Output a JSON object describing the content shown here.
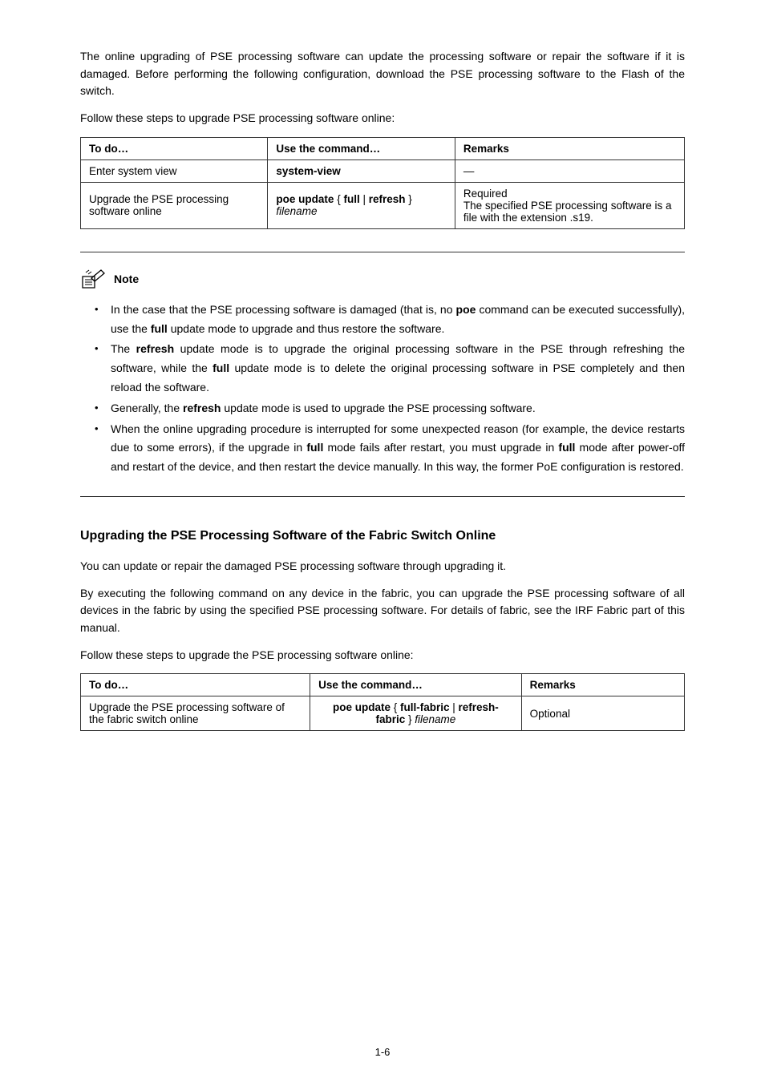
{
  "intro": {
    "p1": "The online upgrading of PSE processing software can update the processing software or repair the software if it is damaged. Before performing the following configuration, download the PSE processing software to the Flash of the switch.",
    "p2": "Follow these steps to upgrade PSE processing software online:"
  },
  "table1": {
    "headers": {
      "c1": "To do…",
      "c2": "Use the command…",
      "c3": "Remarks"
    },
    "rows": [
      {
        "c1": "Enter system view",
        "c2": "system-view",
        "c3": "—"
      },
      {
        "c1": "Upgrade the PSE processing software online",
        "c2": "poe update { full | refresh } filename",
        "c3": "Required\nThe specified PSE processing software is a file with the extension .s19."
      }
    ]
  },
  "note": {
    "label": "Note",
    "bullets": [
      {
        "parts": [
          "In the case that the PSE processing software is damaged (that is, no ",
          {
            "bold": "poe"
          },
          " command can be executed successfully), use the ",
          {
            "bold": "full"
          },
          " update mode to upgrade and thus restore the software."
        ]
      },
      {
        "parts": [
          "The ",
          {
            "bold": "refresh"
          },
          " update mode is to upgrade the original processing software in the PSE through refreshing the software, while the ",
          {
            "bold": "full"
          },
          " update mode is to delete the original processing software in PSE completely and then reload the software."
        ]
      },
      {
        "parts": [
          "Generally, the ",
          {
            "bold": "refresh"
          },
          " update mode is used to upgrade the PSE processing software."
        ]
      },
      {
        "parts": [
          "When the online upgrading procedure is interrupted for some unexpected reason (for example, the device restarts due to some errors), if the upgrade in ",
          {
            "bold": "full"
          },
          " mode fails after restart, you must upgrade in ",
          {
            "bold": "full"
          },
          " mode after power-off and restart of the device, and then restart the device manually. In this way, the former PoE configuration is restored."
        ]
      }
    ]
  },
  "section2": {
    "heading": "Upgrading the PSE Processing Software of the Fabric Switch Online",
    "p1": "You can update or repair the damaged PSE processing software through upgrading it.",
    "p2": "By executing the following command on any device in the fabric, you can upgrade the PSE processing software of all devices in the fabric by using the specified PSE processing software. For details of fabric, see the IRF Fabric part of this manual.",
    "p3": "Follow these steps to upgrade the PSE processing software online:"
  },
  "table2": {
    "headers": {
      "c1": "To do…",
      "c2": "Use the command…",
      "c3": "Remarks"
    },
    "rows": [
      {
        "c1": "Upgrade the PSE processing software of the fabric switch online",
        "c2": "poe update { full-fabric | refresh-fabric } filename",
        "c3": "Optional"
      }
    ]
  },
  "footer": "1-6"
}
